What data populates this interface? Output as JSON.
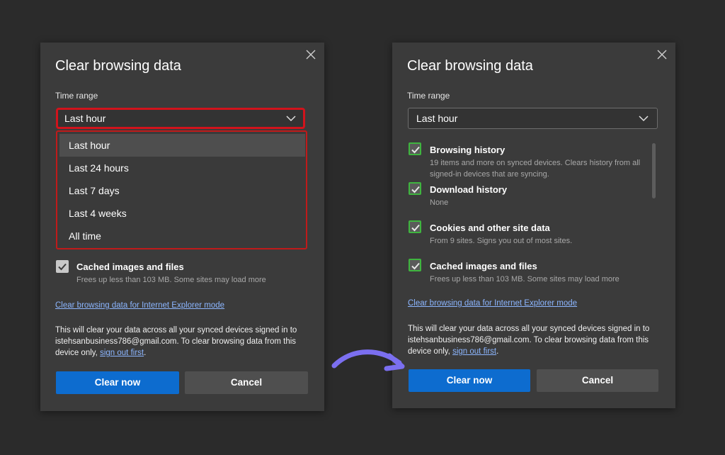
{
  "left_dialog": {
    "title": "Clear browsing data",
    "time_range_label": "Time range",
    "selected_range": "Last hour",
    "dropdown_options": [
      "Last hour",
      "Last 24 hours",
      "Last 7 days",
      "Last 4 weeks",
      "All time"
    ],
    "cached_item": {
      "title": "Cached images and files",
      "description": "Frees up less than 103 MB. Some sites may load more"
    },
    "ie_link": "Clear browsing data for Internet Explorer mode",
    "notice_text": "This will clear your data across all your synced devices signed in to istehsanbusiness786@gmail.com. To clear browsing data from this device only,",
    "signout_link": "sign out first",
    "notice_end": ".",
    "clear_button": "Clear now",
    "cancel_button": "Cancel"
  },
  "right_dialog": {
    "title": "Clear browsing data",
    "time_range_label": "Time range",
    "selected_range": "Last hour",
    "items": [
      {
        "title": "Browsing history",
        "description": "19 items and more on synced devices. Clears history from all signed-in devices that are syncing.",
        "checked": true
      },
      {
        "title": "Download history",
        "description": "None",
        "checked": true
      },
      {
        "title": "Cookies and other site data",
        "description": "From 9 sites. Signs you out of most sites.",
        "checked": true
      },
      {
        "title": "Cached images and files",
        "description": "Frees up less than 103 MB. Some sites may load more",
        "checked": true
      }
    ],
    "ie_link": "Clear browsing data for Internet Explorer mode",
    "notice_text": "This will clear your data across all your synced devices signed in to istehsanbusiness786@gmail.com. To clear browsing data from this device only,",
    "signout_link": "sign out first",
    "notice_end": ".",
    "clear_button": "Clear now",
    "cancel_button": "Cancel"
  },
  "colors": {
    "background": "#2b2b2b",
    "dialog": "#3b3b3b",
    "primary_button": "#0d6ccf",
    "highlight_border": "#d1131c",
    "checkbox_border": "#3fb53f",
    "link": "#8cb6ff",
    "arrow": "#7b6ff0"
  },
  "icons": {
    "close": "close-icon",
    "chevron": "chevron-down-icon",
    "check": "checkmark-icon",
    "arrow": "curved-arrow-icon"
  }
}
